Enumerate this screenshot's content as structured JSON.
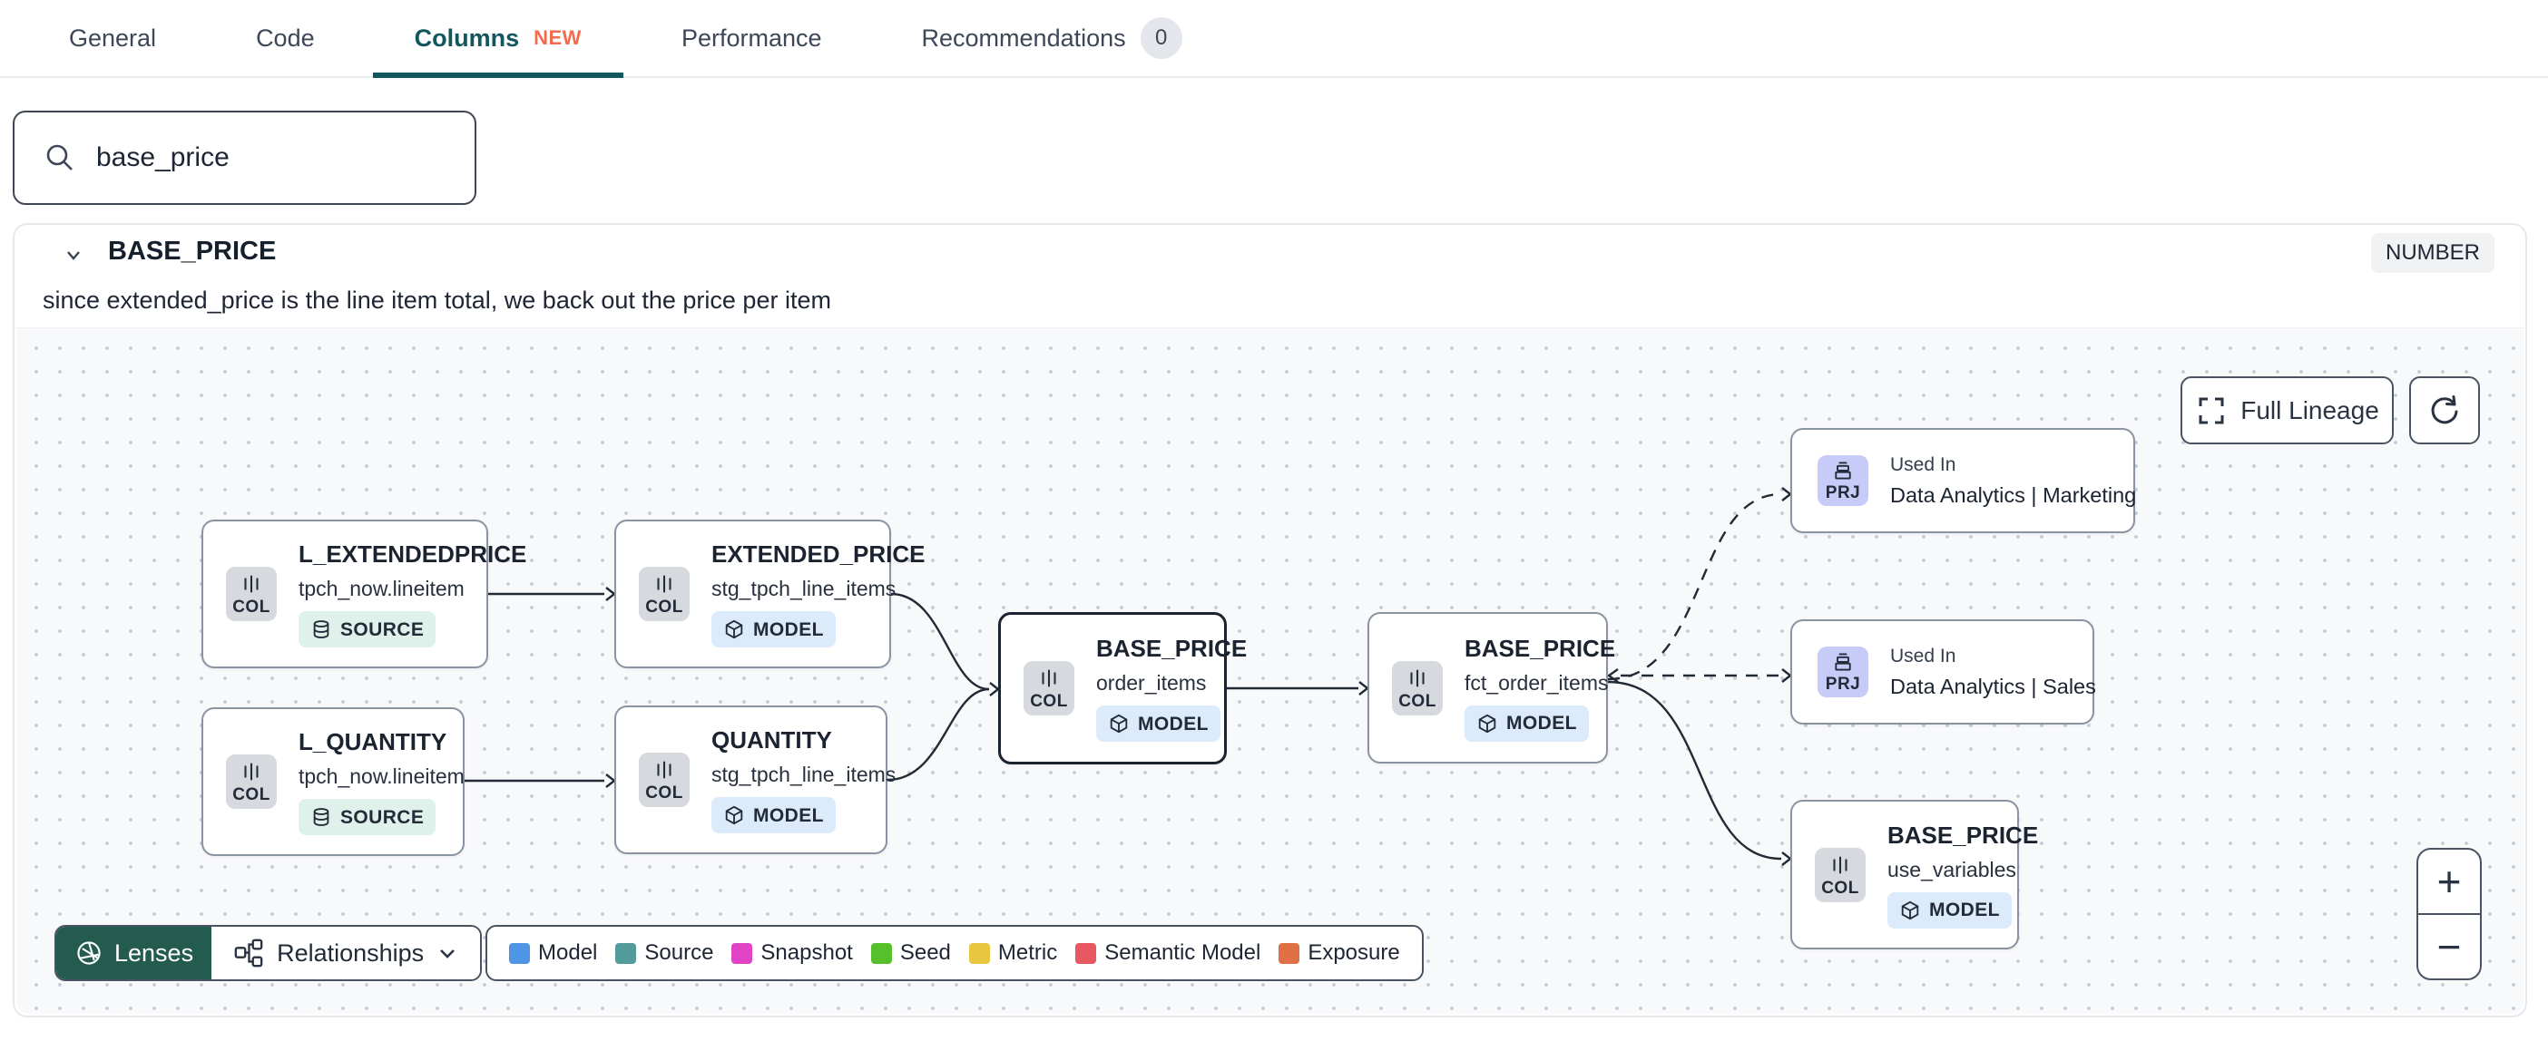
{
  "tabs": [
    {
      "label": "General"
    },
    {
      "label": "Code"
    },
    {
      "label": "Columns",
      "badge": "NEW",
      "active": true
    },
    {
      "label": "Performance"
    },
    {
      "label": "Recommendations",
      "badge": "0"
    }
  ],
  "search": {
    "value": "base_price"
  },
  "column_panel": {
    "name": "BASE_PRICE",
    "type_badge": "NUMBER",
    "description": "since extended_price is the line item total, we back out the price per item"
  },
  "lineage": {
    "controls": {
      "full_lineage": "Full Lineage",
      "zoom_in": "+",
      "zoom_out": "−"
    },
    "toolbar": {
      "lenses": "Lenses",
      "relationships": "Relationships"
    },
    "legend": [
      {
        "label": "Model",
        "color": "#4E95E5"
      },
      {
        "label": "Source",
        "color": "#549B9B"
      },
      {
        "label": "Snapshot",
        "color": "#E143C6"
      },
      {
        "label": "Seed",
        "color": "#56C02B"
      },
      {
        "label": "Metric",
        "color": "#E8C63F"
      },
      {
        "label": "Semantic Model",
        "color": "#E85862"
      },
      {
        "label": "Exposure",
        "color": "#DF7144"
      }
    ],
    "nodes": [
      {
        "chip": "COL",
        "title": "L_EXTENDEDPRICE",
        "subtitle": "tpch_now.lineitem",
        "badge": "SOURCE"
      },
      {
        "chip": "COL",
        "title": "L_QUANTITY",
        "subtitle": "tpch_now.lineitem",
        "badge": "SOURCE"
      },
      {
        "chip": "COL",
        "title": "EXTENDED_PRICE",
        "subtitle": "stg_tpch_line_items",
        "badge": "MODEL"
      },
      {
        "chip": "COL",
        "title": "QUANTITY",
        "subtitle": "stg_tpch_line_items",
        "badge": "MODEL"
      },
      {
        "chip": "COL",
        "title": "BASE_PRICE",
        "subtitle": "order_items",
        "badge": "MODEL",
        "selected": true
      },
      {
        "chip": "COL",
        "title": "BASE_PRICE",
        "subtitle": "fct_order_items",
        "badge": "MODEL"
      },
      {
        "chip": "PRJ",
        "used_in": "Used In",
        "title": "Data Analytics | Marketing"
      },
      {
        "chip": "PRJ",
        "used_in": "Used In",
        "title": "Data Analytics | Sales"
      },
      {
        "chip": "COL",
        "title": "BASE_PRICE",
        "subtitle": "use_variables",
        "badge": "MODEL"
      }
    ]
  },
  "colors": {
    "accent_teal": "#12565E",
    "new_badge_orange": "#F26B4E",
    "lenses_green": "#235B4E",
    "selected_node_border": "#1B2330",
    "source_badge_bg": "#DFF1EB",
    "model_badge_bg": "#DCEBFB",
    "project_chip_bg": "#C6CBF8",
    "column_chip_bg": "#D6D9DE"
  }
}
